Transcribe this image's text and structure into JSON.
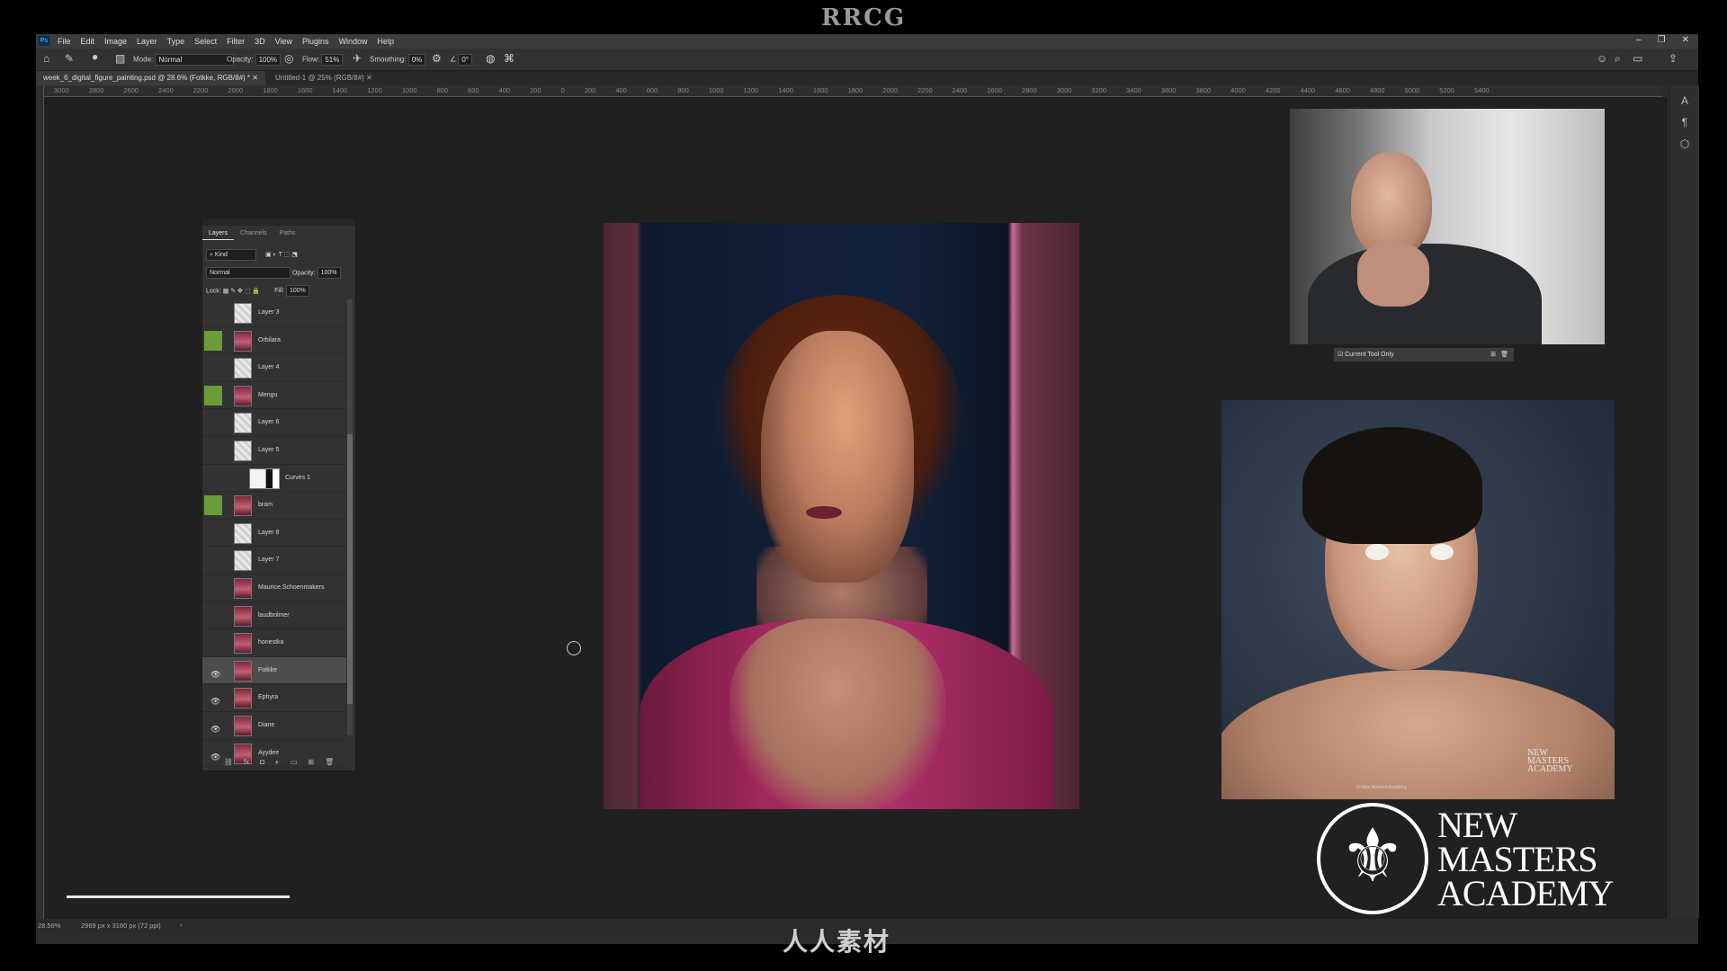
{
  "watermark": {
    "top": "RRCG",
    "bottom": "人人素材"
  },
  "menu": {
    "items": [
      "File",
      "Edit",
      "Image",
      "Layer",
      "Type",
      "Select",
      "Filter",
      "3D",
      "View",
      "Plugins",
      "Window",
      "Help"
    ],
    "logo": "Ps"
  },
  "options": {
    "mode_label": "Mode:",
    "mode_value": "Normal",
    "opacity_label": "Opacity:",
    "opacity_value": "100%",
    "flow_label": "Flow:",
    "flow_value": "51%",
    "smoothing_label": "Smoothing:",
    "smoothing_value": "0%",
    "angle_value": "0°"
  },
  "tabs": [
    {
      "label": "week_6_digital_figure_painting.psd @ 28.6% (Fotkke, RGB/8#) *"
    },
    {
      "label": "Untitled-1 @ 25% (RGB/8#)"
    }
  ],
  "ruler": [
    "3000",
    "2800",
    "2600",
    "2400",
    "2200",
    "2000",
    "1800",
    "1600",
    "1400",
    "1200",
    "1000",
    "800",
    "600",
    "400",
    "200",
    "0",
    "200",
    "400",
    "600",
    "800",
    "1000",
    "1200",
    "1400",
    "1600",
    "1800",
    "2000",
    "2200",
    "2400",
    "2600",
    "2800",
    "3000",
    "3200",
    "3400",
    "3600",
    "3800",
    "4000",
    "4200",
    "4400",
    "4600",
    "4800",
    "5000",
    "5200",
    "5400"
  ],
  "layers_panel": {
    "tabs": [
      "Layers",
      "Channels",
      "Paths"
    ],
    "filter": "Kind",
    "blend_mode": "Normal",
    "opacity_label": "Opacity:",
    "opacity_value": "100%",
    "lock_label": "Lock:",
    "fill_label": "Fill:",
    "fill_value": "100%",
    "layers": [
      {
        "name": "Layer 3",
        "thumb": "blank",
        "visible": false,
        "green": false
      },
      {
        "name": "Orbilara",
        "thumb": "port",
        "visible": false,
        "green": true
      },
      {
        "name": "Layer 4",
        "thumb": "blank",
        "visible": false,
        "green": false
      },
      {
        "name": "Mengu",
        "thumb": "port",
        "visible": false,
        "green": true
      },
      {
        "name": "Layer 6",
        "thumb": "blank",
        "visible": false,
        "green": false
      },
      {
        "name": "Layer 5",
        "thumb": "blank",
        "visible": false,
        "green": false
      },
      {
        "name": "Curves 1",
        "thumb": "adj",
        "visible": false,
        "green": false
      },
      {
        "name": "bram",
        "thumb": "port",
        "visible": false,
        "green": true
      },
      {
        "name": "Layer 8",
        "thumb": "blank",
        "visible": false,
        "green": false
      },
      {
        "name": "Layer 7",
        "thumb": "blank",
        "visible": false,
        "green": false
      },
      {
        "name": "Maurice.Schoenmakers",
        "thumb": "port",
        "visible": false,
        "green": false
      },
      {
        "name": "laudbolmer",
        "thumb": "port",
        "visible": false,
        "green": false
      },
      {
        "name": "honestka",
        "thumb": "port",
        "visible": false,
        "green": false
      },
      {
        "name": "Fotkke",
        "thumb": "port",
        "visible": true,
        "green": false,
        "selected": true
      },
      {
        "name": "Ephyra",
        "thumb": "port",
        "visible": true,
        "green": false
      },
      {
        "name": "Diane",
        "thumb": "port",
        "visible": true,
        "green": false
      },
      {
        "name": "Ayydee",
        "thumb": "port",
        "visible": true,
        "green": false
      }
    ]
  },
  "camera_control": {
    "label": "Current Tool Only"
  },
  "status": {
    "zoom": "28.56%",
    "doc": "2969 px x 3160 px (72 ppi)"
  },
  "nma_logo": {
    "line1": "NEW",
    "line2": "MASTERS",
    "line3": "ACADEMY"
  },
  "ref_logo": {
    "line1": "NEW",
    "line2": "MASTERS",
    "line3": "ACADEMY",
    "credit": "© New Masters Academy"
  }
}
